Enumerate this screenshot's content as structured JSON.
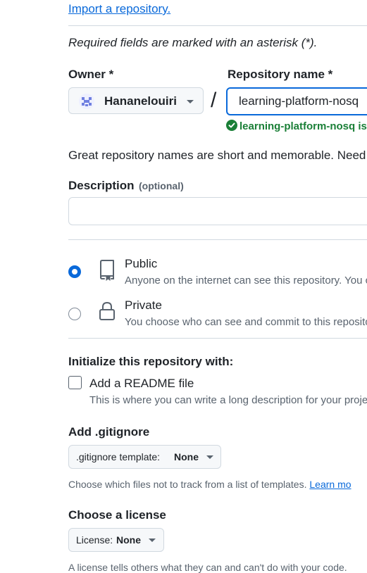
{
  "import_link": "Import a repository.",
  "required_note": "Required fields are marked with an asterisk (*).",
  "owner": {
    "label": "Owner *",
    "value": "Hananelouiri"
  },
  "slash": "/",
  "repo_name": {
    "label": "Repository name *",
    "value": "learning-platform-nosq"
  },
  "availability": "learning-platform-nosq is",
  "name_hint": "Great repository names are short and memorable. Need",
  "description": {
    "label": "Description",
    "optional": "(optional)",
    "value": ""
  },
  "visibility": {
    "public": {
      "title": "Public",
      "desc": "Anyone on the internet can see this repository. You c",
      "selected": true
    },
    "private": {
      "title": "Private",
      "desc": "You choose who can see and commit to this reposito",
      "selected": false
    }
  },
  "initialize": {
    "heading": "Initialize this repository with:",
    "readme_label": "Add a README file",
    "readme_checked": false,
    "readme_desc": "This is where you can write a long description for your proje"
  },
  "gitignore": {
    "heading": "Add .gitignore",
    "button_prefix": ".gitignore template:",
    "button_value": "None",
    "desc": "Choose which files not to track from a list of templates.",
    "learn_more": "Learn mo"
  },
  "license": {
    "heading": "Choose a license",
    "button_prefix": "License:",
    "button_value": "None",
    "desc": "A license tells others what they can and can't do with your code."
  },
  "colors": {
    "accent": "#0969da",
    "success": "#1a7f37",
    "border": "#d1d9e0",
    "muted_text": "#59636e",
    "button_bg": "#f6f8fa"
  }
}
